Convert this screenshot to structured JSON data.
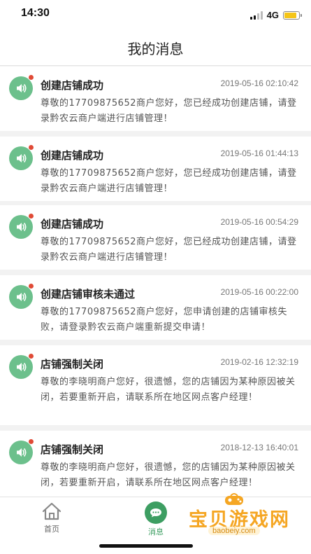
{
  "status": {
    "time": "14:30",
    "network": "4G",
    "battery_level": 0.85
  },
  "nav": {
    "title": "我的消息"
  },
  "messages": [
    {
      "title": "创建店铺成功",
      "time": "2019-05-16 02:10:42",
      "body": "尊敬的17709875652商户您好，您已经成功创建店铺，请登录黔农云商户端进行店铺管理！",
      "unread": true
    },
    {
      "title": "创建店铺成功",
      "time": "2019-05-16 01:44:13",
      "body": "尊敬的17709875652商户您好，您已经成功创建店铺，请登录黔农云商户端进行店铺管理！",
      "unread": true
    },
    {
      "title": "创建店铺成功",
      "time": "2019-05-16 00:54:29",
      "body": "尊敬的17709875652商户您好，您已经成功创建店铺，请登录黔农云商户端进行店铺管理！",
      "unread": true
    },
    {
      "title": "创建店铺审核未通过",
      "time": "2019-05-16 00:22:00",
      "body": "尊敬的17709875652商户您好，您申请创建的店铺审核失败，请登录黔农云商户端重新提交申请！",
      "unread": true
    },
    {
      "title": "店铺强制关闭",
      "time": "2019-02-16 12:32:19",
      "body": "尊敬的李晓明商户您好，很遗憾，您的店铺因为某种原因被关闭，若要重新开启，请联系所在地区网点客户经理！",
      "unread": true
    },
    {
      "title": "店铺强制关闭",
      "time": "2018-12-13 16:40:01",
      "body": "尊敬的李晓明商户您好，很遗憾，您的店铺因为某种原因被关闭，若要重新开启，请联系所在地区网点客户经理！",
      "unread": true
    }
  ],
  "tabs": [
    {
      "label": "首页",
      "icon": "home-icon",
      "active": false
    },
    {
      "label": "消息",
      "icon": "chat-icon",
      "active": true
    }
  ],
  "watermark": {
    "text": "宝贝游戏网",
    "url": "baobeiy.com"
  },
  "colors": {
    "accent": "#3d9e62",
    "avatar": "#6cc08c",
    "unread": "#e04a36",
    "watermark": "#f5a623"
  }
}
